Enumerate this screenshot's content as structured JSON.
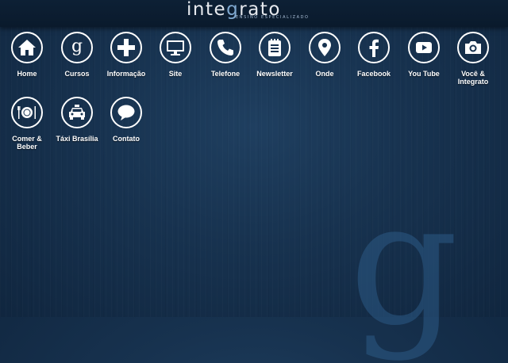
{
  "header": {
    "logo_text_prefix": "inte",
    "logo_text_g": "g",
    "logo_text_suffix": "rato",
    "logo_tagline": "ENSINO ESPECIALIZADO"
  },
  "background": {
    "watermark": "g"
  },
  "colors": {
    "background": "#17324f",
    "icon": "#ffffff",
    "accent": "#7fa8d0"
  },
  "tiles": [
    {
      "label": "Home",
      "icon": "house-icon"
    },
    {
      "label": "Cursos",
      "icon": "g-logo-icon"
    },
    {
      "label": "Informação",
      "icon": "plus-icon"
    },
    {
      "label": "Site",
      "icon": "monitor-icon"
    },
    {
      "label": "Telefone",
      "icon": "phone-icon"
    },
    {
      "label": "Newsletter",
      "icon": "notepad-icon"
    },
    {
      "label": "Onde",
      "icon": "map-pin-icon"
    },
    {
      "label": "Facebook",
      "icon": "facebook-icon"
    },
    {
      "label": "You Tube",
      "icon": "youtube-icon"
    },
    {
      "label": "Você & Integrato",
      "icon": "camera-icon"
    },
    {
      "label": "Comer & Beber",
      "icon": "plate-cutlery-icon"
    },
    {
      "label": "Táxi Brasília",
      "icon": "taxi-icon"
    },
    {
      "label": "Contato",
      "icon": "speech-bubble-icon"
    }
  ]
}
